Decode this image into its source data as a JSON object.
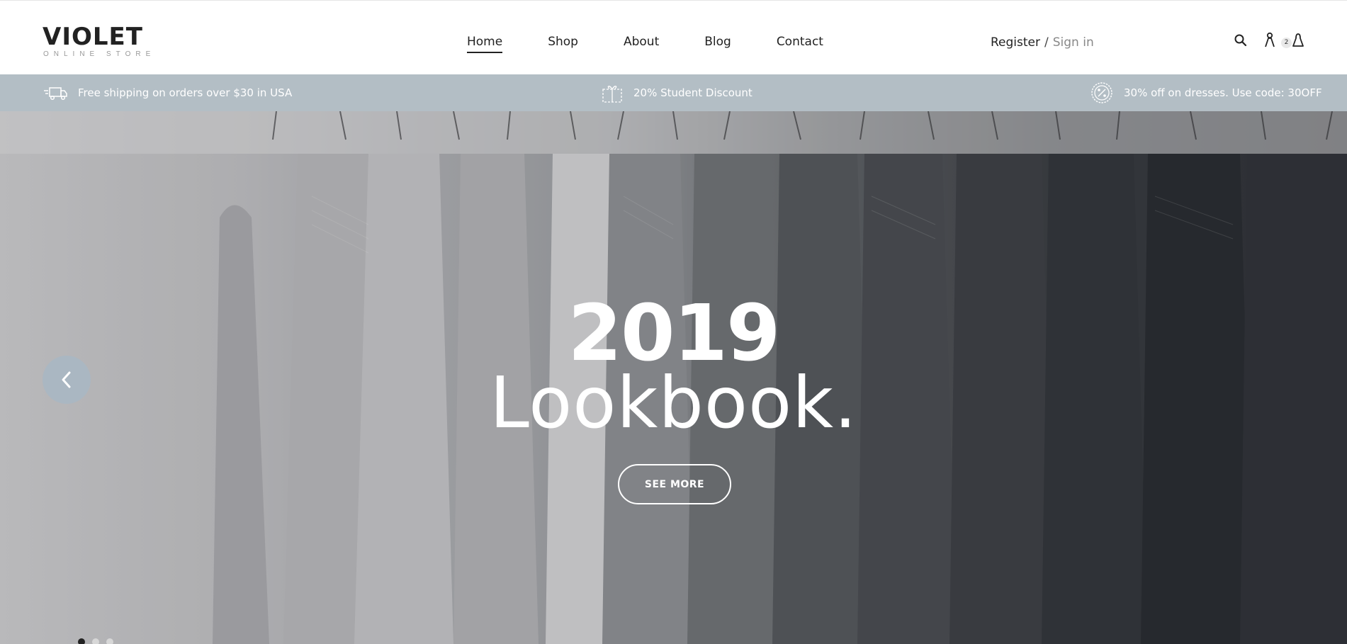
{
  "brand": {
    "name": "VIOLET",
    "tagline": "ONLINE STORE"
  },
  "nav": [
    {
      "label": "Home",
      "active": true
    },
    {
      "label": "Shop",
      "active": false
    },
    {
      "label": "About",
      "active": false
    },
    {
      "label": "Blog",
      "active": false
    },
    {
      "label": "Contact",
      "active": false
    }
  ],
  "auth": {
    "register": "Register",
    "separator": "/",
    "sign_in": "Sign in"
  },
  "header_icons": {
    "search": "search-icon",
    "account": "user-icon",
    "cart": "bag-icon",
    "cart_count": "2"
  },
  "promo": [
    {
      "icon": "truck-icon",
      "text": "Free shipping on orders over $30 in USA"
    },
    {
      "icon": "gift-icon",
      "text": "20% Student Discount"
    },
    {
      "icon": "percent-badge-icon",
      "text": "30% off on dresses. Use code: 30OFF"
    }
  ],
  "hero": {
    "year": "2019",
    "title": "Lookbook.",
    "button": "SEE MORE",
    "prev_icon": "chevron-left-icon",
    "slides": 3,
    "active_slide": 1
  },
  "colors": {
    "promo_bg": "#b3bec5",
    "prev_button_bg": "#aab7c2",
    "text_dark": "#222222",
    "sign_in": "#888888"
  }
}
